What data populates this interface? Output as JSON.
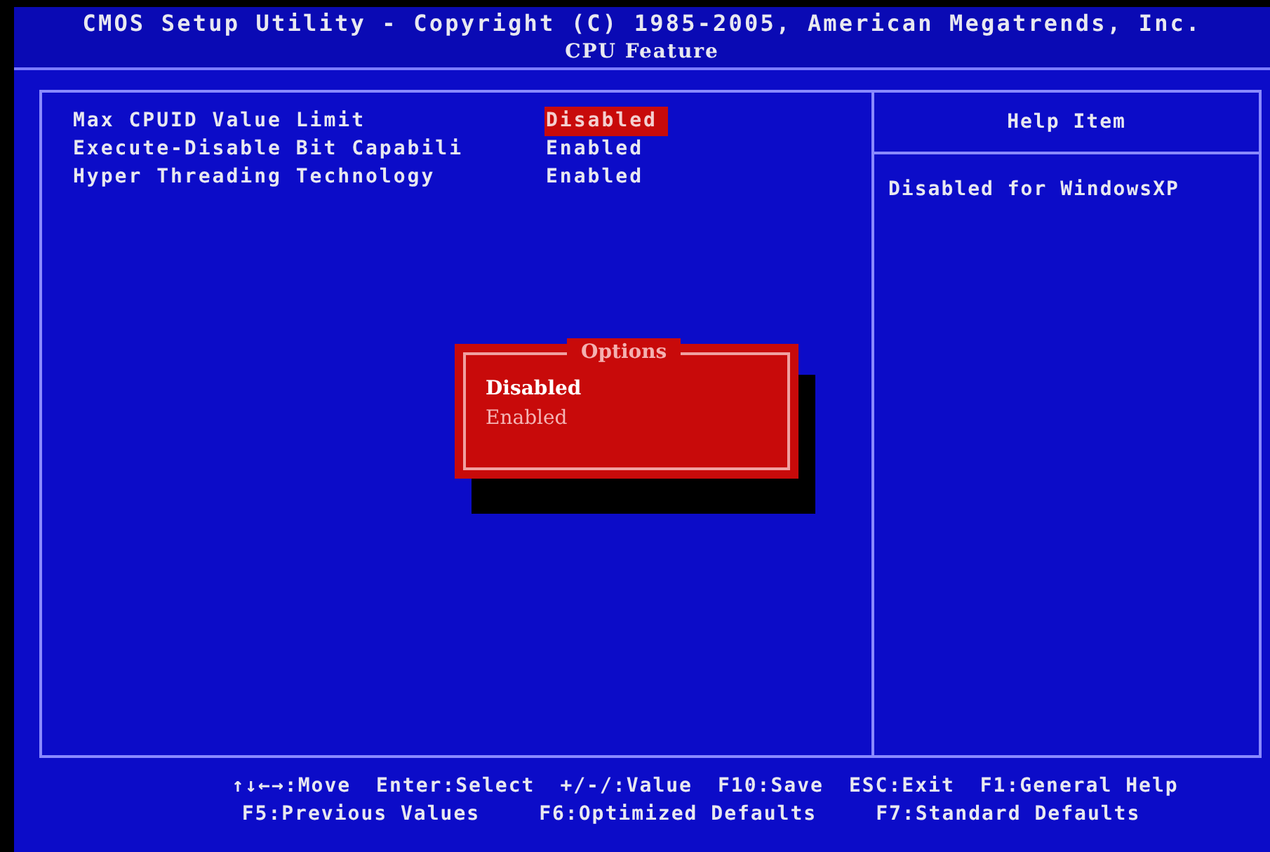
{
  "header": {
    "title": "CMOS Setup Utility - Copyright (C) 1985-2005, American Megatrends, Inc.",
    "subtitle": "CPU Feature"
  },
  "settings": [
    {
      "label": "Max CPUID Value Limit",
      "value": "Disabled",
      "selected": true
    },
    {
      "label": "Execute-Disable Bit Capabili",
      "value": "Enabled",
      "selected": false
    },
    {
      "label": "Hyper Threading Technology",
      "value": "Enabled",
      "selected": false
    }
  ],
  "help": {
    "title": "Help Item",
    "text": "Disabled for WindowsXP"
  },
  "options_popup": {
    "title": "Options",
    "options": [
      {
        "label": "Disabled",
        "selected": true
      },
      {
        "label": "Enabled",
        "selected": false
      }
    ]
  },
  "key_help": [
    [
      "↑↓←→:Move",
      "Enter:Select",
      "+/-/:Value",
      "F10:Save",
      "ESC:Exit",
      "F1:General Help"
    ],
    [
      "F5:Previous Values",
      "F6:Optimized Defaults",
      "F7:Standard Defaults"
    ]
  ]
}
